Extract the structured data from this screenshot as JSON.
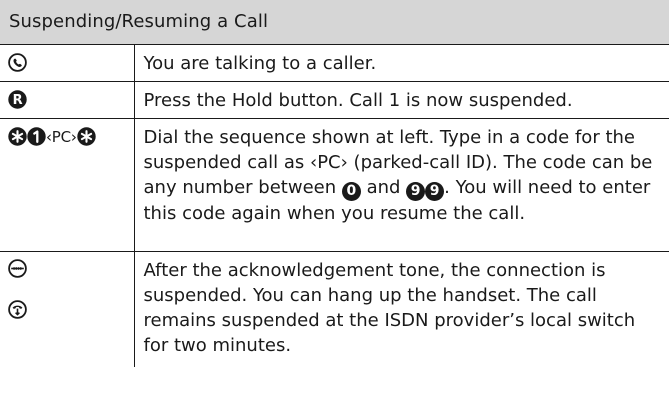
{
  "title": "Suspending/Resuming a Call",
  "rows": [
    {
      "icons": [
        "handset-off-hook-icon"
      ],
      "text": "You are talking to a caller."
    },
    {
      "icons": [
        "R-key-icon"
      ],
      "text": "Press the Hold button. Call 1 is now suspended."
    },
    {
      "icons": [
        "star-key-icon",
        "1-key-icon",
        "star-key-icon"
      ],
      "pc_label": "‹PC›",
      "text_parts": {
        "a": "Dial the sequence shown at left. Type in a code for the suspended call as ‹PC› (parked-call ID). The code can be any number between ",
        "key_0": "0",
        "b": " and ",
        "key_9": "9",
        "c": ". You will need to enter this code again when you resume the call."
      }
    },
    {
      "icons": [
        "acknowledgement-tone-icon",
        "handset-on-hook-icon"
      ],
      "text": "After the acknowledgement tone, the connection is suspended. You can hang up the handset. The call remains suspended at the ISDN provider’s local switch for two minutes."
    }
  ],
  "colors": {
    "title_background": "#d6d6d6",
    "text": "#1a1a1a",
    "rule": "#1a1a1a",
    "page_background": "#ffffff"
  }
}
